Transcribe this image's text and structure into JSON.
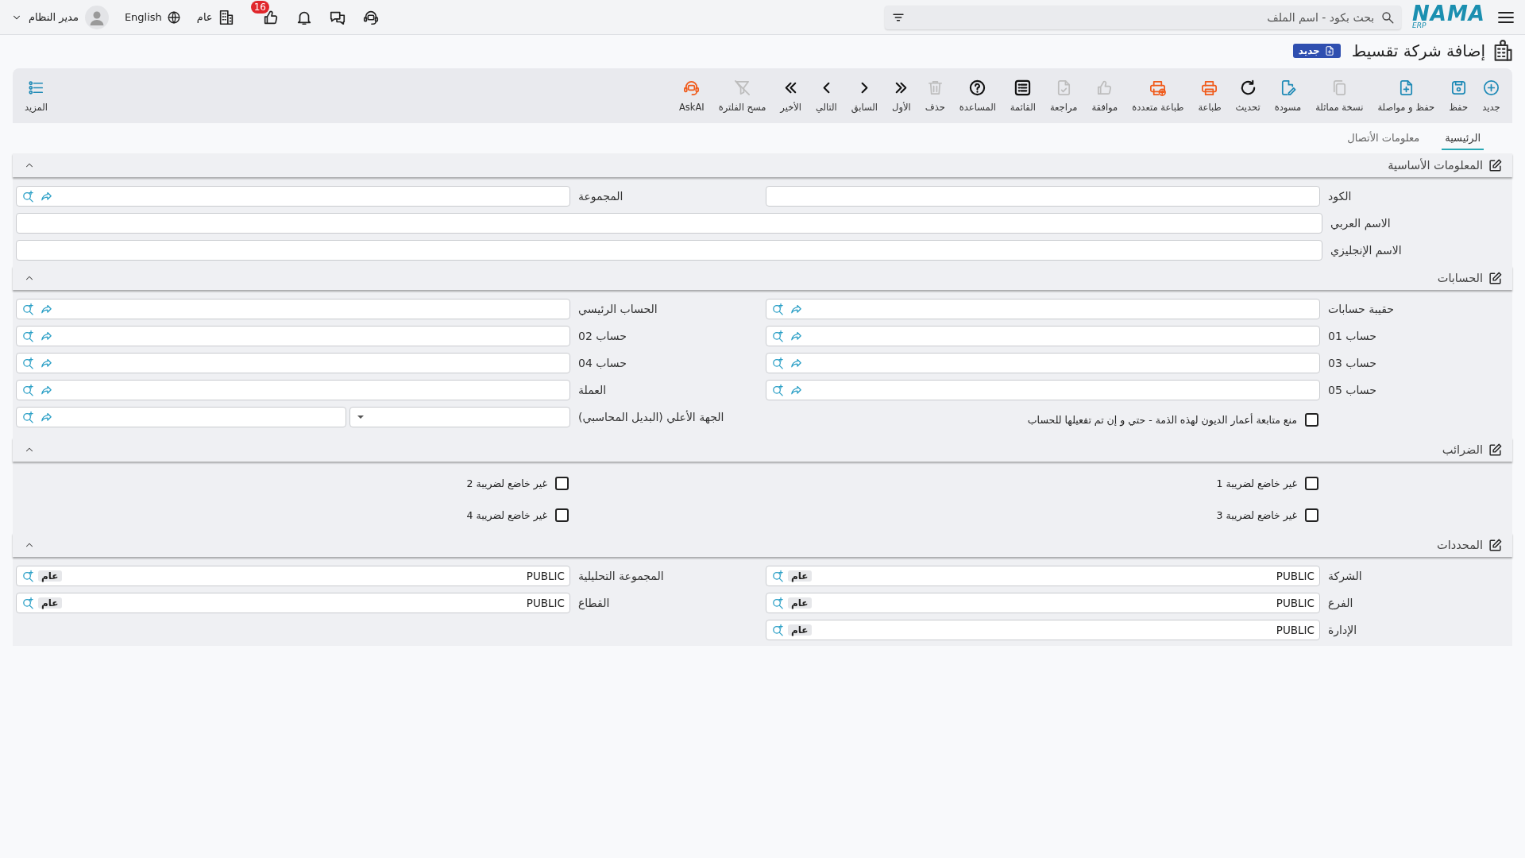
{
  "topbar": {
    "logo": {
      "name": "NAMA",
      "suffix": "ERP"
    },
    "search": {
      "placeholder": "بحث بكود - اسم الملف"
    },
    "company": "عام",
    "likes_badge": "16",
    "language": "English",
    "user": "مدير النظام"
  },
  "page": {
    "title": "إضافة شركة تقسيط",
    "status": "جديد"
  },
  "toolbar": [
    {
      "kind": "new",
      "label": "جديد",
      "disabled": false
    },
    {
      "kind": "save",
      "label": "حفظ",
      "disabled": false
    },
    {
      "kind": "save-continue",
      "label": "حفظ و مواصلة",
      "disabled": false
    },
    {
      "kind": "duplicate",
      "label": "نسخة مماثلة",
      "disabled": true
    },
    {
      "kind": "draft",
      "label": "مسودة",
      "disabled": false
    },
    {
      "kind": "refresh",
      "label": "تحديث",
      "disabled": false
    },
    {
      "kind": "print",
      "label": "طباعة",
      "disabled": false
    },
    {
      "kind": "multi-print",
      "label": "طباعة متعددة",
      "disabled": false
    },
    {
      "kind": "approve",
      "label": "موافقة",
      "disabled": true
    },
    {
      "kind": "review",
      "label": "مراجعة",
      "disabled": true
    },
    {
      "kind": "list",
      "label": "القائمة",
      "disabled": false
    },
    {
      "kind": "help",
      "label": "المساعدة",
      "disabled": false
    },
    {
      "kind": "delete",
      "label": "حذف",
      "disabled": true
    },
    {
      "kind": "first",
      "label": "الأول",
      "disabled": false
    },
    {
      "kind": "previous",
      "label": "السابق",
      "disabled": false
    },
    {
      "kind": "next",
      "label": "التالي",
      "disabled": false
    },
    {
      "kind": "last",
      "label": "الأخير",
      "disabled": false
    },
    {
      "kind": "clear-filter",
      "label": "مسح الفلترة",
      "disabled": true
    },
    {
      "kind": "ask-ai",
      "label": "AskAI",
      "disabled": false
    }
  ],
  "more": {
    "label": "المزيد"
  },
  "tabs": [
    {
      "label": "الرئيسية",
      "selected": true
    },
    {
      "label": "معلومات الأتصال",
      "selected": false
    }
  ],
  "sections": [
    {
      "title": "المعلومات الأساسية",
      "expanded": true,
      "fields": [
        {
          "kind": "text",
          "label": "الكود"
        },
        {
          "kind": "lookup",
          "label": "المجموعة"
        },
        {
          "kind": "wide-text",
          "label": "الاسم العربي"
        },
        {
          "kind": "wide-text",
          "label": "الاسم الإنجليزي"
        }
      ]
    },
    {
      "title": "الحسابات",
      "expanded": true,
      "fields": [
        {
          "kind": "lookup",
          "label": "حقيبة حسابات"
        },
        {
          "kind": "lookup",
          "label": "الحساب الرئيسي"
        },
        {
          "kind": "lookup",
          "label": "حساب 01"
        },
        {
          "kind": "lookup",
          "label": "حساب 02"
        },
        {
          "kind": "lookup",
          "label": "حساب 03"
        },
        {
          "kind": "lookup",
          "label": "حساب 04"
        },
        {
          "kind": "lookup",
          "label": "حساب 05"
        },
        {
          "kind": "lookup",
          "label": "العملة"
        },
        {
          "kind": "checkbox",
          "label": "منع متابعة أعمار الديون لهذه الذمة - حتي و إن تم تفعيلها للحساب",
          "checked": false
        },
        {
          "kind": "lookup-select",
          "label": "الجهة الأعلي (البديل المحاسبي)"
        }
      ]
    },
    {
      "title": "الضرائب",
      "expanded": true,
      "fields": [
        {
          "kind": "checkbox",
          "label": "غير خاضع لضريبة 1",
          "checked": false
        },
        {
          "kind": "checkbox",
          "label": "غير خاضع لضريبة 2",
          "checked": false
        },
        {
          "kind": "checkbox",
          "label": "غير خاضع لضريبة 3",
          "checked": false
        },
        {
          "kind": "checkbox",
          "label": "غير خاضع لضريبة 4",
          "checked": false
        }
      ]
    },
    {
      "title": "المحددات",
      "expanded": true,
      "fields": [
        {
          "kind": "dimension",
          "label": "الشركة",
          "value": "PUBLIC",
          "tag": "عام"
        },
        {
          "kind": "dimension",
          "label": "المجموعة التحليلية",
          "value": "PUBLIC",
          "tag": "عام"
        },
        {
          "kind": "dimension",
          "label": "الفرع",
          "value": "PUBLIC",
          "tag": "عام"
        },
        {
          "kind": "dimension",
          "label": "القطاع",
          "value": "PUBLIC",
          "tag": "عام"
        },
        {
          "kind": "dimension",
          "label": "الإدارة",
          "value": "PUBLIC",
          "tag": "عام"
        }
      ]
    }
  ]
}
